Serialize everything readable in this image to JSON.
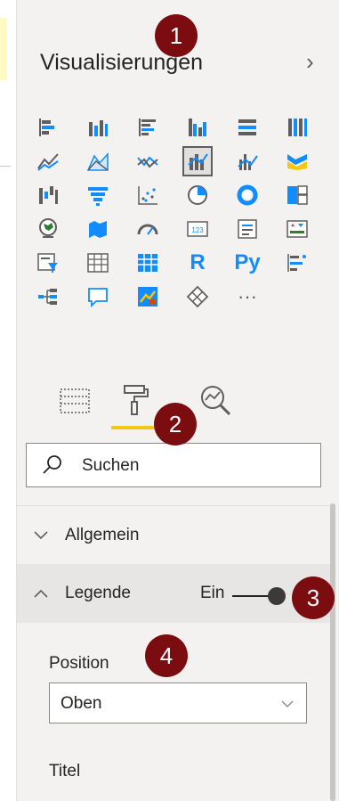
{
  "panel": {
    "title": "Visualisierungen",
    "collapse_icon": "chevron-right-icon"
  },
  "visual_icons": [
    "stacked-bar-chart-icon",
    "stacked-column-chart-icon",
    "clustered-bar-chart-icon",
    "clustered-column-chart-icon",
    "100-stacked-bar-chart-icon",
    "100-stacked-column-chart-icon",
    "line-chart-icon",
    "area-chart-icon",
    "stacked-area-chart-icon",
    "line-and-stacked-column-icon",
    "line-and-clustered-column-icon",
    "ribbon-chart-icon",
    "waterfall-chart-icon",
    "funnel-icon",
    "scatter-chart-icon",
    "pie-chart-icon",
    "donut-chart-icon",
    "treemap-icon",
    "map-icon",
    "filled-map-icon",
    "gauge-icon",
    "card-icon",
    "multi-row-card-icon",
    "kpi-icon",
    "slicer-icon",
    "table-icon",
    "matrix-icon",
    "r-visual-icon",
    "python-visual-icon",
    "key-influencers-icon",
    "decomposition-tree-icon",
    "qa-icon",
    "smart-narrative-icon",
    "paginated-report-icon",
    "more-visuals-icon"
  ],
  "visual_text_icons": {
    "r": "R",
    "py": "Py",
    "more": "···",
    "card": "123"
  },
  "tabs": [
    {
      "name": "fields-tab",
      "icon": "fields-icon"
    },
    {
      "name": "format-tab",
      "icon": "paint-roller-icon",
      "active": true
    },
    {
      "name": "analytics-tab",
      "icon": "analytics-magnifier-icon"
    }
  ],
  "search": {
    "placeholder": "Suchen",
    "icon": "search-icon"
  },
  "sections": [
    {
      "label": "Allgemein",
      "expanded": false
    },
    {
      "label": "Legende",
      "expanded": true,
      "toggle_label": "Ein",
      "toggle_on": true
    }
  ],
  "legend": {
    "position_label": "Position",
    "position_value": "Oben",
    "title_label": "Titel"
  },
  "badges": [
    "1",
    "2",
    "3",
    "4"
  ],
  "colors": {
    "accent": "#f2c811",
    "badge": "#7b0d10",
    "icon_blue": "#118dff"
  }
}
